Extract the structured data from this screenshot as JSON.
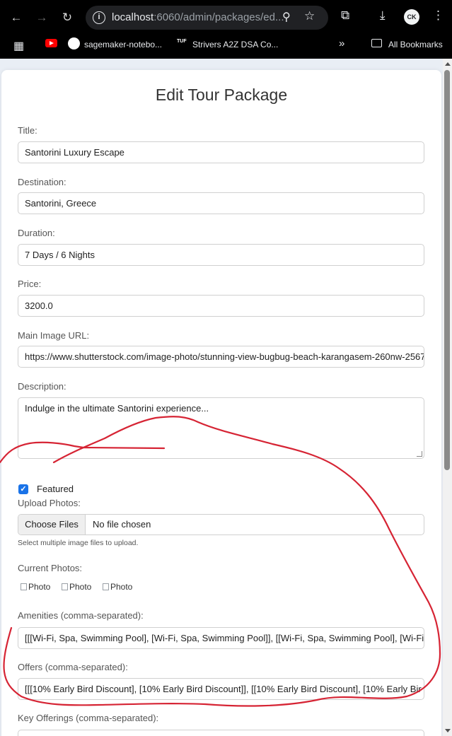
{
  "browser": {
    "url_host": "localhost",
    "url_rest": ":6060/admin/packages/ed...",
    "profile_initials": "CK",
    "bookmarks": [
      "sagemaker-notebo...",
      "Strivers A2Z DSA Co...",
      "All Bookmarks"
    ],
    "tuf_label": "TUF"
  },
  "form": {
    "title": "Edit Tour Package",
    "title_label": "Title:",
    "title_value": "Santorini Luxury Escape",
    "destination_label": "Destination:",
    "destination_value": "Santorini, Greece",
    "duration_label": "Duration:",
    "duration_value": "7 Days / 6 Nights",
    "price_label": "Price:",
    "price_value": "3200.0",
    "image_label": "Main Image URL:",
    "image_value": "https://www.shutterstock.com/image-photo/stunning-view-bugbug-beach-karangasem-260nw-2567",
    "description_label": "Description:",
    "description_value": "Indulge in the ultimate Santorini experience...",
    "featured_label": "Featured",
    "upload_label": "Upload Photos:",
    "choose_files": "Choose Files",
    "no_file": "No file chosen",
    "upload_help": "Select multiple image files to upload.",
    "current_photos_label": "Current Photos:",
    "photos": [
      "Photo",
      "Photo",
      "Photo"
    ],
    "amenities_label": "Amenities (comma-separated):",
    "amenities_value": "[[[Wi-Fi, Spa, Swimming Pool], [Wi-Fi, Spa, Swimming Pool]], [[Wi-Fi, Spa, Swimming Pool], [Wi-Fi",
    "offers_label": "Offers (comma-separated):",
    "offers_value": "[[[10% Early Bird Discount], [10% Early Bird Discount]], [[10% Early Bird Discount], [10% Early Bir",
    "key_offerings_label": "Key Offerings (comma-separated):"
  },
  "colors": {
    "annotation": "#d62434",
    "checkbox": "#1a73e8"
  }
}
